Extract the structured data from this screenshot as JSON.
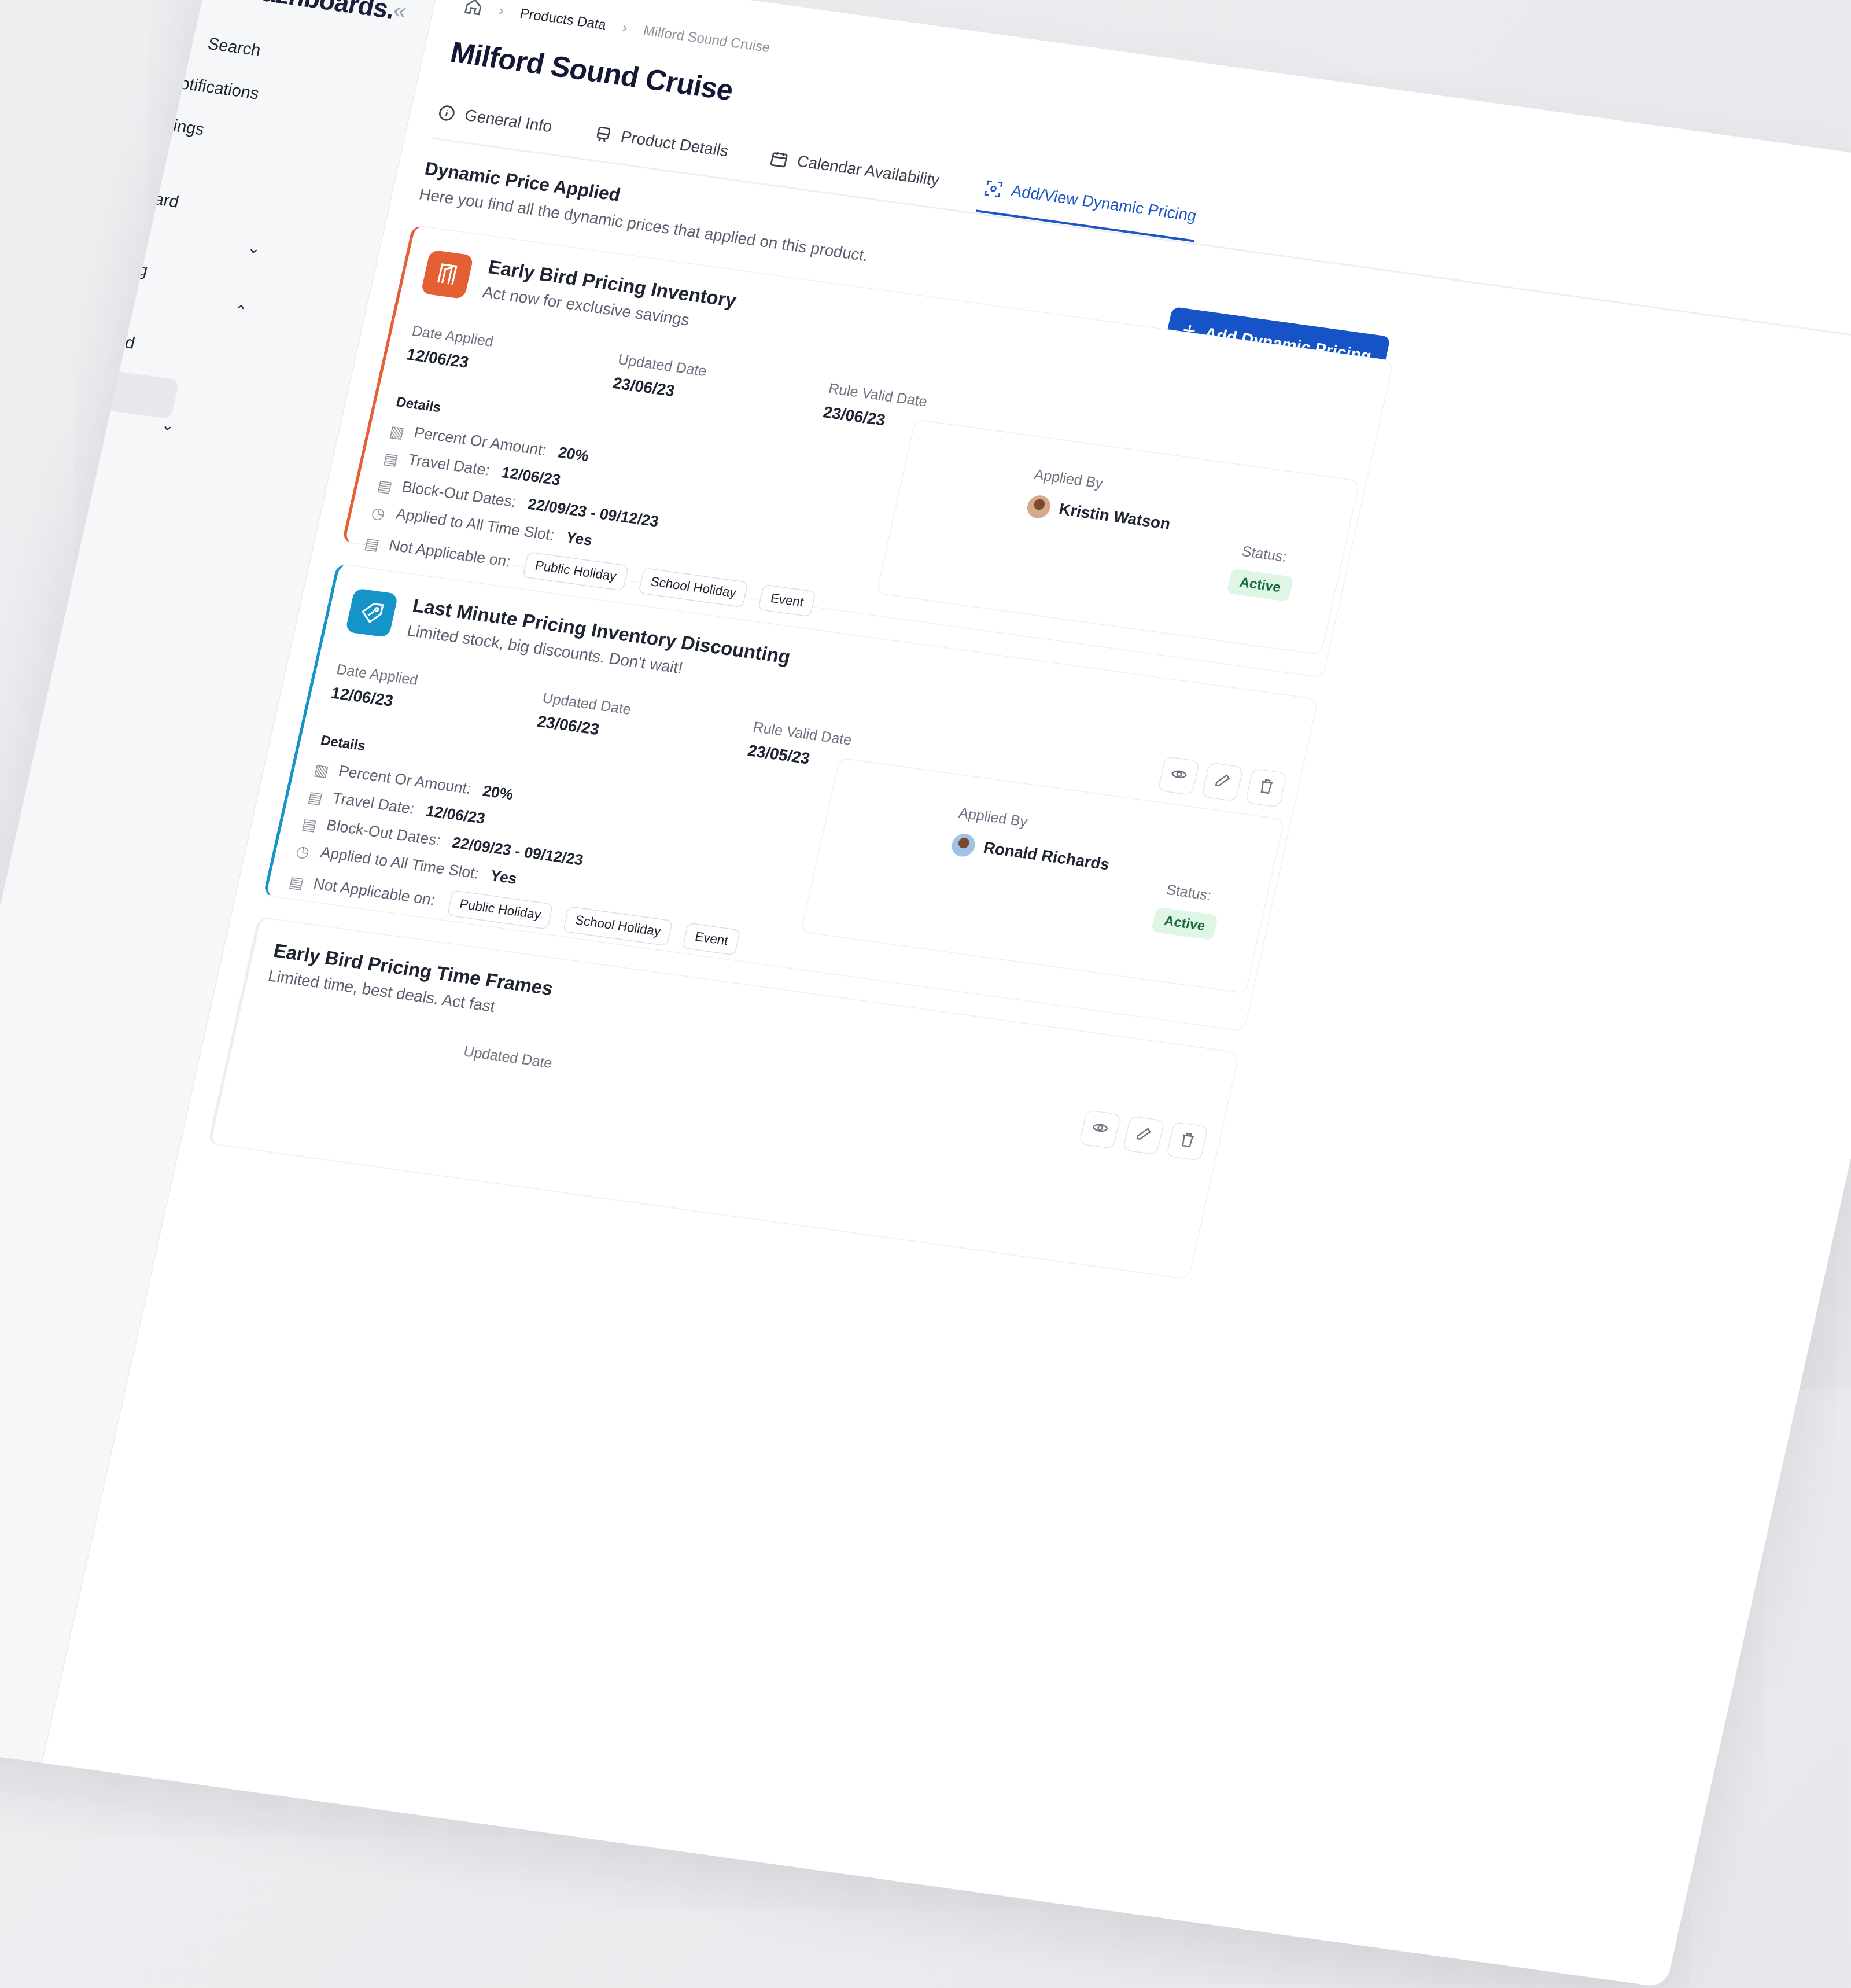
{
  "app": {
    "brand": "Dazhboards."
  },
  "sidebar": {
    "items": [
      {
        "label": "Search",
        "icon": "search-icon"
      },
      {
        "label": "Notifications",
        "icon": "bell-icon"
      },
      {
        "label": "Settings",
        "icon": "gear-icon"
      },
      {
        "label": "Dashboard",
        "icon": "grid-icon"
      },
      {
        "label": "Pricing",
        "icon": "tag-icon"
      },
      {
        "label": "Dashboard",
        "icon": "grid-icon"
      }
    ]
  },
  "breadcrumb": {
    "items": [
      "Products Data",
      "Milford Sound Cruise"
    ]
  },
  "page": {
    "title": "Milford Sound Cruise"
  },
  "tabs": [
    {
      "label": "General Info",
      "icon": "info-icon"
    },
    {
      "label": "Product Details",
      "icon": "train-icon"
    },
    {
      "label": "Calendar Availability",
      "icon": "calendar-icon"
    },
    {
      "label": "Add/View Dynamic Pricing",
      "icon": "price-scan-icon",
      "active": true
    }
  ],
  "section": {
    "title": "Dynamic Price Applied",
    "subtitle": "Here you find all the dynamic prices that applied on this product."
  },
  "add_button": {
    "label": "Add Dynamic Pricing"
  },
  "labels": {
    "date_applied": "Date Applied",
    "updated_date": "Updated Date",
    "rule_valid_date": "Rule Valid Date",
    "details": "Details",
    "percent_or_amount": "Percent Or Amount:",
    "travel_date": "Travel Date:",
    "block_out_dates": "Block-Out Dates:",
    "applied_all_slots": "Applied to All Time Slot:",
    "not_applicable_on": "Not Applicable on:",
    "applied_by": "Applied By",
    "status": "Status:"
  },
  "cards": [
    {
      "title": "Early Bird Pricing Inventory",
      "subtitle": "Act now for exclusive savings",
      "accent": "#e55f34",
      "icon": "door-icon",
      "date_applied": "12/06/23",
      "updated_date": "23/06/23",
      "rule_valid_date": "23/06/23",
      "percent": "20%",
      "travel_date": "12/06/23",
      "block_out": "22/09/23 - 09/12/23",
      "all_slots": "Yes",
      "chips": [
        "Public Holiday",
        "School Holiday",
        "Event"
      ],
      "applied_by": "Kristin Watson",
      "status": "Active"
    },
    {
      "title": "Last Minute Pricing Inventory Discounting",
      "subtitle": "Limited stock, big discounts. Don't wait!",
      "accent": "#1594c9",
      "icon": "discount-tag-icon",
      "date_applied": "12/06/23",
      "updated_date": "23/06/23",
      "rule_valid_date": "23/05/23",
      "percent": "20%",
      "travel_date": "12/06/23",
      "block_out": "22/09/23 - 09/12/23",
      "all_slots": "Yes",
      "chips": [
        "Public Holiday",
        "School Holiday",
        "Event"
      ],
      "applied_by": "Ronald Richards",
      "status": "Active"
    },
    {
      "title": "Early Bird Pricing Time Frames",
      "subtitle": "Limited time, best deals. Act fast",
      "updated_date_label": "Updated Date"
    }
  ]
}
